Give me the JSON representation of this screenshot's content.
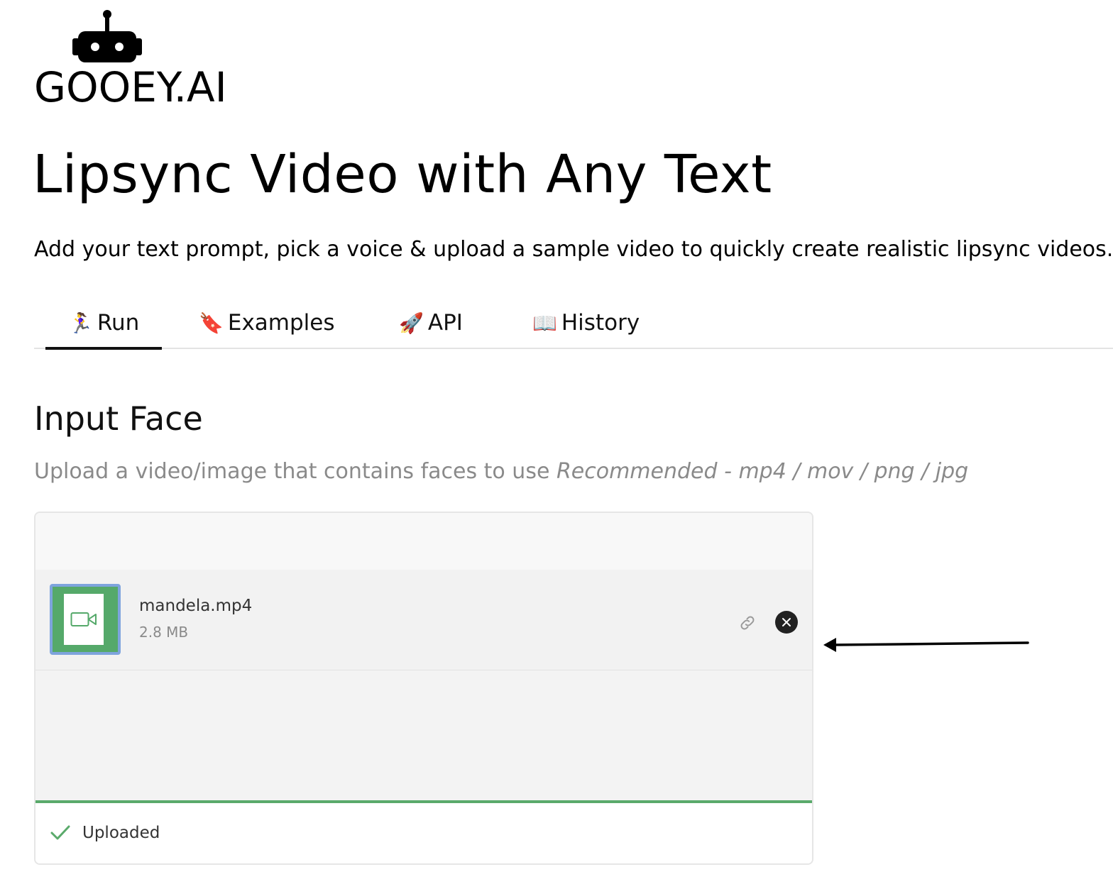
{
  "brand": {
    "logo_text": "GOOEY.AI"
  },
  "page": {
    "title": "Lipsync Video with Any Text",
    "subtitle": "Add your text prompt, pick a voice & upload a sample video to quickly create realistic lipsync videos. D"
  },
  "tabs": [
    {
      "icon": "🏃‍♀️",
      "label": "Run",
      "active": true
    },
    {
      "icon": "🔖",
      "label": "Examples",
      "active": false
    },
    {
      "icon": "🚀",
      "label": "API",
      "active": false
    },
    {
      "icon": "📖",
      "label": "History",
      "active": false
    }
  ],
  "input_face": {
    "title": "Input Face",
    "help_text": "Upload a video/image that contains faces to use ",
    "help_recommended": "Recommended - mp4 / mov / png / jpg",
    "file": {
      "name": "mandela.mp4",
      "size": "2.8 MB",
      "icon": "video-camera-icon"
    },
    "status": "Uploaded",
    "progress": 1.0
  },
  "colors": {
    "accent_green": "#5aaa6b",
    "thumb_border": "#7ea4dd",
    "muted_text": "#8a8a8a"
  }
}
